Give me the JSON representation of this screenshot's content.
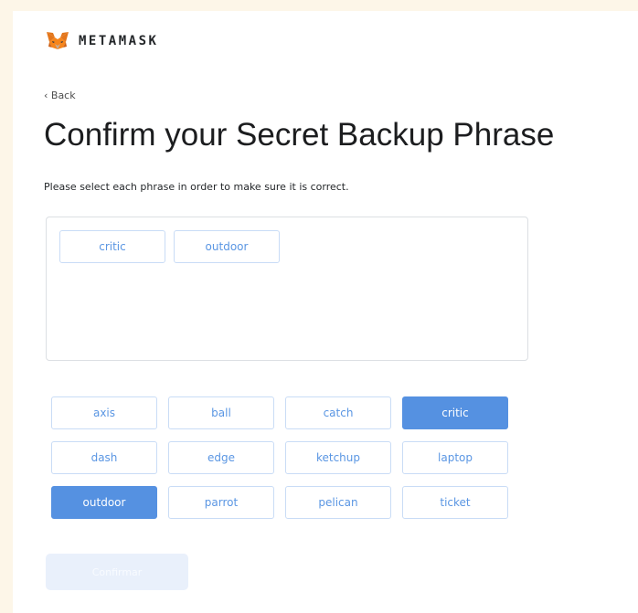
{
  "brand": {
    "name": "METAMASK"
  },
  "nav": {
    "back_label": "‹ Back"
  },
  "page": {
    "title": "Confirm your Secret Backup Phrase",
    "subtitle": "Please select each phrase in order to make sure it is correct."
  },
  "selected_words": [
    "critic",
    "outdoor"
  ],
  "word_bank": [
    {
      "word": "axis",
      "selected": false
    },
    {
      "word": "ball",
      "selected": false
    },
    {
      "word": "catch",
      "selected": false
    },
    {
      "word": "critic",
      "selected": true
    },
    {
      "word": "dash",
      "selected": false
    },
    {
      "word": "edge",
      "selected": false
    },
    {
      "word": "ketchup",
      "selected": false
    },
    {
      "word": "laptop",
      "selected": false
    },
    {
      "word": "outdoor",
      "selected": true
    },
    {
      "word": "parrot",
      "selected": false
    },
    {
      "word": "pelican",
      "selected": false
    },
    {
      "word": "ticket",
      "selected": false
    }
  ],
  "confirm_button": {
    "label": "Confirmar",
    "enabled": false
  },
  "colors": {
    "accent": "#5591e1",
    "chip_border": "#c9dcf6",
    "chip_text": "#5a96e3",
    "page_bg": "#fdf6e8",
    "button_disabled": "#e9f0fb"
  }
}
